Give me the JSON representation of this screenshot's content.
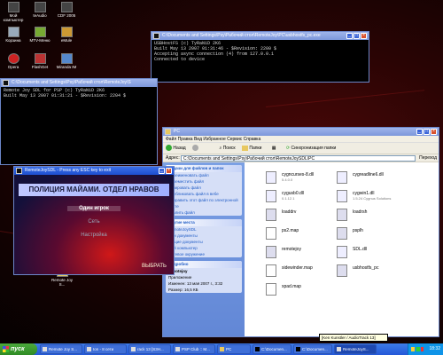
{
  "desktop": {
    "icons": [
      {
        "label": "Мой компьютер"
      },
      {
        "label": "teAudio"
      },
      {
        "label": "CDF 2005"
      },
      {
        "label": "Корзина"
      },
      {
        "label": "MTV-Меню"
      },
      {
        "label": "eMule"
      },
      {
        "label": "Opera"
      },
      {
        "label": "FlashGet"
      },
      {
        "label": "Miranda IM"
      },
      {
        "label": "Remote Joy S..."
      }
    ]
  },
  "console_top": {
    "title": "C:\\Documents and Settings\\Psy\\Рабочий стол\\RemoteJoy\\PC\\usbhostfs_pc.exe",
    "lines": [
      "USBHostFS (c) TyRaNiD 2K6",
      "Built May 13 2007 01:31:46 - $Revision: 2200 $",
      "Accepting async connection (4) from 127.0.0.1",
      "Connected to device"
    ]
  },
  "console_left": {
    "title": "C:\\Documents and Settings\\Psy\\Рабочий стол\\RemoteJoy\\S",
    "lines": [
      "Remote Joy SDL for PSP (c) TyRaNiD 2K6",
      "Built May 13 2007 01:31:21 - $Revision: 2204 $"
    ]
  },
  "explorer": {
    "title": "PC",
    "menu": "Файл Правка Вид Избранное Сервис Справка",
    "toolbar": {
      "back": "Назад",
      "search": "Поиск",
      "folders": "Папки",
      "sync": "Синхронизация папки"
    },
    "address_label": "Адрес:",
    "address": "C:\\Documents and Settings\\Psy\\Рабочий стол\\RemoteJoySDL\\PC",
    "go": "Переход",
    "taskpane": {
      "tasks_title": "Задачи для файлов и папок",
      "tasks": [
        "Переименовать файл",
        "Переместить файл",
        "Копировать файл",
        "Опубликовать файл в вебе",
        "Отправить этот файл по электронной почте",
        "Удалить файл"
      ],
      "places_title": "Другие места",
      "places": [
        "RemoteJoySDL",
        "Мои документы",
        "Общие документы",
        "Мой компьютер",
        "Сетевое окружение"
      ],
      "details_title": "Подробно",
      "details_name": "remotejoy",
      "details_type": "Приложение",
      "details_modified": "Изменен: 13 мая 2007 г., 3:32",
      "details_size": "Размер: 16,5 КБ"
    },
    "files": [
      {
        "name": "cygncurses-8.dll",
        "sub": "5.4.0.0"
      },
      {
        "name": "cygreadline6.dll",
        "sub": ""
      },
      {
        "name": "cygusb0.dll",
        "sub": "0.1.12.1"
      },
      {
        "name": "cygwin1.dll",
        "sub": "1.5.24 Cygnus Solutions"
      },
      {
        "name": "loaddrv",
        "sub": ""
      },
      {
        "name": "loadrsh",
        "sub": ""
      },
      {
        "name": "ps2.map",
        "sub": ""
      },
      {
        "name": "psplh",
        "sub": ""
      },
      {
        "name": "remotejoy",
        "sub": ""
      },
      {
        "name": "SDL.dll",
        "sub": ""
      },
      {
        "name": "sidewinder.map",
        "sub": ""
      },
      {
        "name": "usbhostfs_pc",
        "sub": ""
      },
      {
        "name": "xpad.map",
        "sub": ""
      }
    ]
  },
  "game_window": {
    "title": "RemoteJoySDL - Press any ESC key to exit",
    "banner": "ПОЛИЦИЯ МАЙАМИ. ОТДЕЛ НРАВОВ",
    "menu": [
      "Один игрок",
      "Сеть",
      "Настройка"
    ],
    "select": "ВЫБРАТЬ"
  },
  "taskbar": {
    "start": "пуск",
    "buttons": [
      "Remote Joy S...",
      "Ion - 8 сети",
      "rack 13 [S3H...",
      "PSP Club :: M...",
      "PC",
      "C:\\Documen...",
      "C:\\Documen...",
      "RemoteJoyS..."
    ],
    "clock": "18:32",
    "tooltip": "[Ken Kunstler / AudioTrack 13]"
  },
  "colors": {
    "xp_blue": "#2458d8",
    "start_green": "#2e8b24",
    "console_bg": "#000000"
  }
}
